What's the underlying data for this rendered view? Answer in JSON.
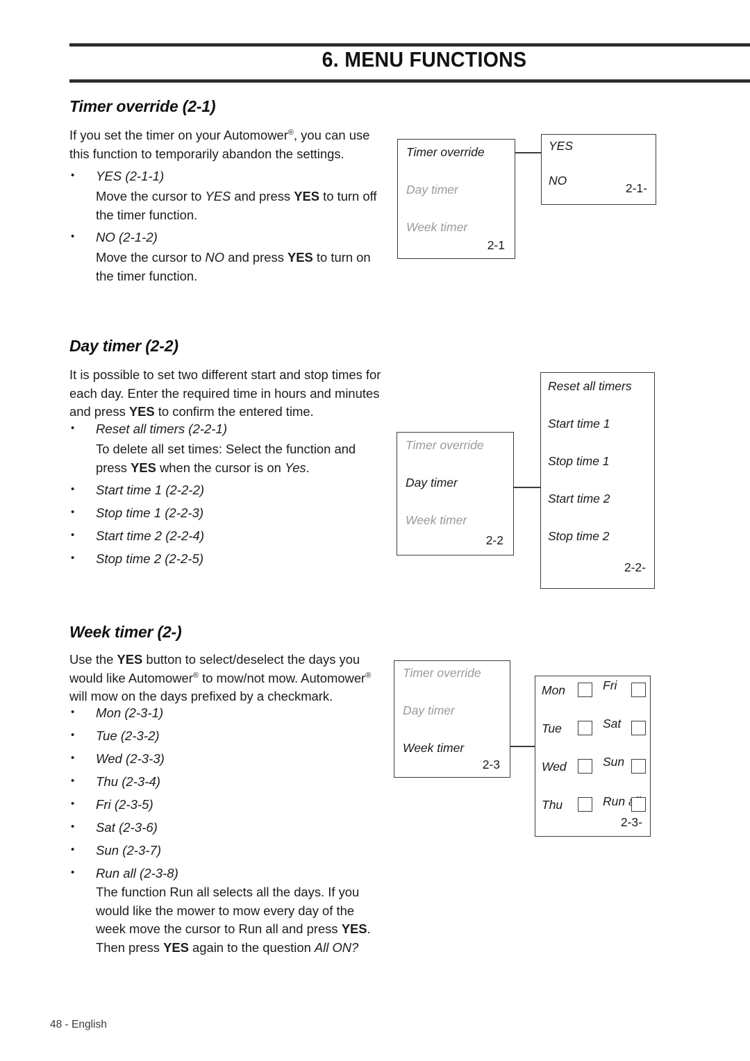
{
  "header": {
    "chapter_title": "6. MENU FUNCTIONS"
  },
  "sections": [
    {
      "heading": "Timer override (2-1)",
      "intro_html": "If you set the timer on your Automower<span class=\"reg\">&reg;</span>, you can use this function to temporarily abandon the settings.",
      "bullets": [
        "YES (2-1-1)",
        "NO (2-1-2)"
      ],
      "sub_paragraphs": [
        "Move the cursor to <i>YES</i> and press <b>YES</b> to turn off the timer function.",
        "Move the cursor to <i>NO</i> and press <b>YES</b> to turn on the timer function."
      ]
    },
    {
      "heading": "Day timer (2-2)",
      "intro_html": "It is possible to set two different start and stop times for each day. Enter the required time in hours and minutes and press <b>YES</b> to confirm the entered time.",
      "bullets": [
        "Reset all timers (2-2-1)",
        "Start time 1 (2-2-2)",
        "Stop time 1 (2-2-3)",
        "Start time 2 (2-2-4)",
        "Stop time 2 (2-2-5)"
      ],
      "sub_paragraphs": [
        "To delete all set times: Select the function and press <b>YES</b> when the cursor is on <i>Yes</i>."
      ]
    },
    {
      "heading": "Week timer (2-)",
      "intro_html": "Use the <b>YES</b> button to select/deselect the days you would like Automower<span class=\"reg\">&reg;</span> to mow/not mow. Automower<span class=\"reg\">&reg;</span> will mow on the days prefixed by a checkmark.",
      "bullets": [
        "Mon (2-3-1)",
        "Tue (2-3-2)",
        "Wed (2-3-3)",
        "Thu (2-3-4)",
        "Fri (2-3-5)",
        "Sat (2-3-6)",
        "Sun (2-3-7)",
        "Run all (2-3-8)"
      ],
      "sub_paragraphs": [
        "The function Run all selects all the days. If you would like the mower to mow every day of the week move the cursor to Run all and press <b>YES</b>. Then press <b>YES</b> again to the question <i>All ON?</i>"
      ]
    }
  ],
  "diagrams": [
    {
      "id": "timer-override",
      "menu_box": {
        "items": [
          {
            "label": "Timer override",
            "active": true
          },
          {
            "label": "Day timer",
            "active": false
          },
          {
            "label": "Week timer",
            "active": false
          }
        ],
        "code": "2-1"
      },
      "detail_box": {
        "items": [
          "YES",
          "NO"
        ],
        "code": "2-1-"
      }
    },
    {
      "id": "day-timer",
      "menu_box": {
        "items": [
          {
            "label": "Timer override",
            "active": false
          },
          {
            "label": "Day timer",
            "active": true
          },
          {
            "label": "Week timer",
            "active": false
          }
        ],
        "code": "2-2"
      },
      "detail_box": {
        "items": [
          "Reset all timers",
          "Start time 1",
          "Stop time 1",
          "Start time 2",
          "Stop time 2"
        ],
        "code": "2-2-"
      }
    },
    {
      "id": "week-timer",
      "menu_box": {
        "items": [
          {
            "label": "Timer override",
            "active": false
          },
          {
            "label": "Day timer",
            "active": false
          },
          {
            "label": "Week timer",
            "active": true
          }
        ],
        "code": "2-3"
      },
      "detail_box": {
        "days_left": [
          "Mon",
          "Tue",
          "Wed",
          "Thu"
        ],
        "days_right": [
          "Fri",
          "Sat",
          "Sun",
          "Run all"
        ],
        "code": "2-3-"
      }
    }
  ],
  "footer": {
    "text": "48 - English"
  }
}
